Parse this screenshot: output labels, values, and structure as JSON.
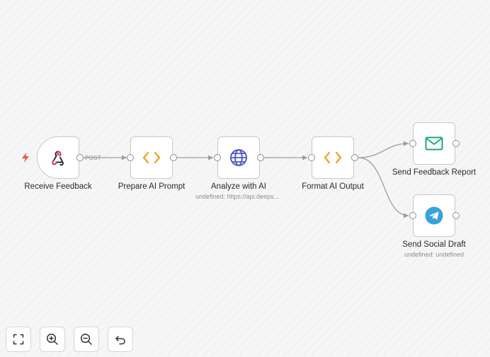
{
  "nodes": {
    "receive_feedback": {
      "label": "Receive Feedback"
    },
    "prepare_prompt": {
      "label": "Prepare AI Prompt"
    },
    "analyze_ai": {
      "label": "Analyze with AI",
      "subtitle": "undefined: https://api.deeps..."
    },
    "format_output": {
      "label": "Format AI Output"
    },
    "send_report": {
      "label": "Send Feedback Report"
    },
    "send_social": {
      "label": "Send Social Draft",
      "subtitle": "undefined: undefined"
    }
  },
  "edges": {
    "webhook_method": "POST"
  },
  "icons": {
    "trigger": "lightning-bolt-icon",
    "receive_feedback": "webhook-icon",
    "prepare_prompt": "code-brackets-icon",
    "analyze_ai": "globe-icon",
    "format_output": "code-brackets-icon",
    "send_report": "envelope-icon",
    "send_social": "telegram-icon",
    "fit_view": "fit-view-icon",
    "zoom_in": "zoom-in-icon",
    "zoom_out": "zoom-out-icon",
    "reset": "undo-icon"
  },
  "colors": {
    "trigger": "#f0564a",
    "code": "#f59e1b",
    "globe": "#4c57c9",
    "email": "#1aa97b",
    "telegram": "#36a2e0",
    "connection": "#9c9c9c"
  }
}
